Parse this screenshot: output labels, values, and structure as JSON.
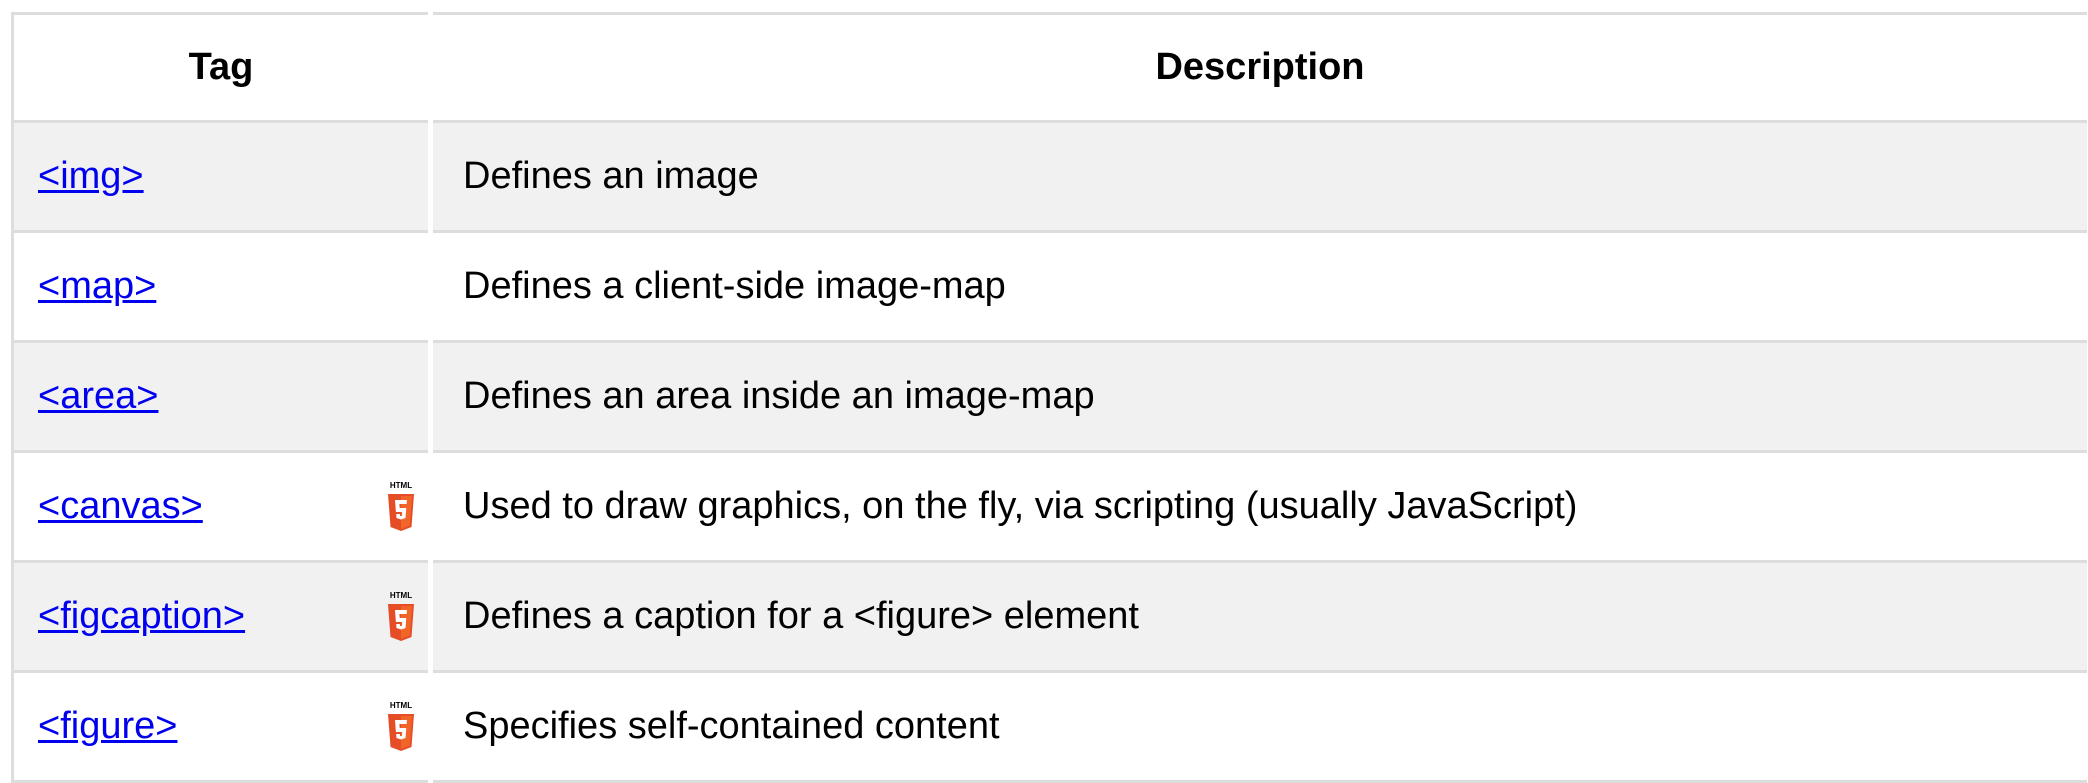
{
  "table": {
    "headers": {
      "tag": "Tag",
      "description": "Description"
    },
    "badge_text": "HTML",
    "rows": [
      {
        "tag": "<img>",
        "description": "Defines an image",
        "html5": false
      },
      {
        "tag": "<map>",
        "description": "Defines a client-side image-map",
        "html5": false
      },
      {
        "tag": "<area>",
        "description": "Defines an area inside an image-map",
        "html5": false
      },
      {
        "tag": "<canvas>",
        "description": "Used to draw graphics, on the fly, via scripting (usually JavaScript)",
        "html5": true
      },
      {
        "tag": "<figcaption>",
        "description": "Defines a caption for a <figure> element",
        "html5": true
      },
      {
        "tag": "<figure>",
        "description": "Specifies self-contained content",
        "html5": true
      }
    ]
  },
  "colors": {
    "link": "#0000ee",
    "stripe": "#f1f1f1",
    "border": "#dddddd",
    "html5_orange": "#e44d26",
    "html5_orange_light": "#f16529"
  },
  "icons": {
    "html5": "html5-icon"
  }
}
